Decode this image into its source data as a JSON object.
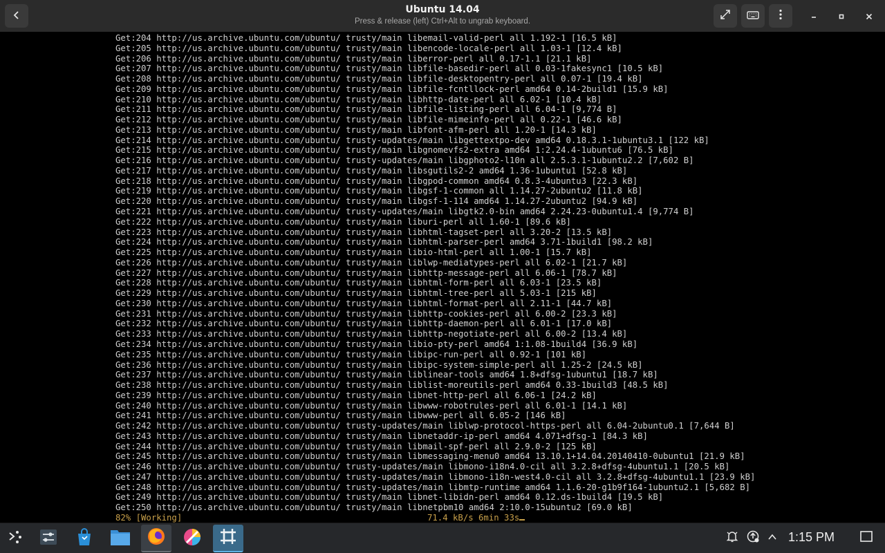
{
  "window": {
    "title": "Ubuntu 14.04",
    "subtitle": "Press & release (left) Ctrl+Alt to ungrab keyboard."
  },
  "icons": {
    "back": "chevron-left-icon",
    "fullscreen": "fullscreen-icon",
    "keyboard": "keyboard-icon",
    "menu": "vertical-dots-icon",
    "minimize": "minimize-icon",
    "maximize": "maximize-icon",
    "close": "close-icon"
  },
  "terminal": {
    "lines": [
      "Get:204 http://us.archive.ubuntu.com/ubuntu/ trusty/main libemail-valid-perl all 1.192-1 [16.5 kB]",
      "Get:205 http://us.archive.ubuntu.com/ubuntu/ trusty/main libencode-locale-perl all 1.03-1 [12.4 kB]",
      "Get:206 http://us.archive.ubuntu.com/ubuntu/ trusty/main liberror-perl all 0.17-1.1 [21.1 kB]",
      "Get:207 http://us.archive.ubuntu.com/ubuntu/ trusty/main libfile-basedir-perl all 0.03-1fakesync1 [10.5 kB]",
      "Get:208 http://us.archive.ubuntu.com/ubuntu/ trusty/main libfile-desktopentry-perl all 0.07-1 [19.4 kB]",
      "Get:209 http://us.archive.ubuntu.com/ubuntu/ trusty/main libfile-fcntllock-perl amd64 0.14-2build1 [15.9 kB]",
      "Get:210 http://us.archive.ubuntu.com/ubuntu/ trusty/main libhttp-date-perl all 6.02-1 [10.4 kB]",
      "Get:211 http://us.archive.ubuntu.com/ubuntu/ trusty/main libfile-listing-perl all 6.04-1 [9,774 B]",
      "Get:212 http://us.archive.ubuntu.com/ubuntu/ trusty/main libfile-mimeinfo-perl all 0.22-1 [46.6 kB]",
      "Get:213 http://us.archive.ubuntu.com/ubuntu/ trusty/main libfont-afm-perl all 1.20-1 [14.3 kB]",
      "Get:214 http://us.archive.ubuntu.com/ubuntu/ trusty-updates/main libgettextpo-dev amd64 0.18.3.1-1ubuntu3.1 [122 kB]",
      "Get:215 http://us.archive.ubuntu.com/ubuntu/ trusty/main libgnomevfs2-extra amd64 1:2.24.4-1ubuntu6 [76.5 kB]",
      "Get:216 http://us.archive.ubuntu.com/ubuntu/ trusty-updates/main libgphoto2-l10n all 2.5.3.1-1ubuntu2.2 [7,602 B]",
      "Get:217 http://us.archive.ubuntu.com/ubuntu/ trusty/main libsgutils2-2 amd64 1.36-1ubuntu1 [52.8 kB]",
      "Get:218 http://us.archive.ubuntu.com/ubuntu/ trusty/main libgpod-common amd64 0.8.3-4ubuntu3 [22.3 kB]",
      "Get:219 http://us.archive.ubuntu.com/ubuntu/ trusty/main libgsf-1-common all 1.14.27-2ubuntu2 [11.8 kB]",
      "Get:220 http://us.archive.ubuntu.com/ubuntu/ trusty/main libgsf-1-114 amd64 1.14.27-2ubuntu2 [94.9 kB]",
      "Get:221 http://us.archive.ubuntu.com/ubuntu/ trusty-updates/main libgtk2.0-bin amd64 2.24.23-0ubuntu1.4 [9,774 B]",
      "Get:222 http://us.archive.ubuntu.com/ubuntu/ trusty/main liburi-perl all 1.60-1 [89.6 kB]",
      "Get:223 http://us.archive.ubuntu.com/ubuntu/ trusty/main libhtml-tagset-perl all 3.20-2 [13.5 kB]",
      "Get:224 http://us.archive.ubuntu.com/ubuntu/ trusty/main libhtml-parser-perl amd64 3.71-1build1 [98.2 kB]",
      "Get:225 http://us.archive.ubuntu.com/ubuntu/ trusty/main libio-html-perl all 1.00-1 [15.7 kB]",
      "Get:226 http://us.archive.ubuntu.com/ubuntu/ trusty/main liblwp-mediatypes-perl all 6.02-1 [21.7 kB]",
      "Get:227 http://us.archive.ubuntu.com/ubuntu/ trusty/main libhttp-message-perl all 6.06-1 [78.7 kB]",
      "Get:228 http://us.archive.ubuntu.com/ubuntu/ trusty/main libhtml-form-perl all 6.03-1 [23.5 kB]",
      "Get:229 http://us.archive.ubuntu.com/ubuntu/ trusty/main libhtml-tree-perl all 5.03-1 [215 kB]",
      "Get:230 http://us.archive.ubuntu.com/ubuntu/ trusty/main libhtml-format-perl all 2.11-1 [44.7 kB]",
      "Get:231 http://us.archive.ubuntu.com/ubuntu/ trusty/main libhttp-cookies-perl all 6.00-2 [23.3 kB]",
      "Get:232 http://us.archive.ubuntu.com/ubuntu/ trusty/main libhttp-daemon-perl all 6.01-1 [17.0 kB]",
      "Get:233 http://us.archive.ubuntu.com/ubuntu/ trusty/main libhttp-negotiate-perl all 6.00-2 [13.4 kB]",
      "Get:234 http://us.archive.ubuntu.com/ubuntu/ trusty/main libio-pty-perl amd64 1:1.08-1build4 [36.9 kB]",
      "Get:235 http://us.archive.ubuntu.com/ubuntu/ trusty/main libipc-run-perl all 0.92-1 [101 kB]",
      "Get:236 http://us.archive.ubuntu.com/ubuntu/ trusty/main libipc-system-simple-perl all 1.25-2 [24.5 kB]",
      "Get:237 http://us.archive.ubuntu.com/ubuntu/ trusty/main liblinear-tools amd64 1.8+dfsg-1ubuntu1 [18.7 kB]",
      "Get:238 http://us.archive.ubuntu.com/ubuntu/ trusty/main liblist-moreutils-perl amd64 0.33-1build3 [48.5 kB]",
      "Get:239 http://us.archive.ubuntu.com/ubuntu/ trusty/main libnet-http-perl all 6.06-1 [24.2 kB]",
      "Get:240 http://us.archive.ubuntu.com/ubuntu/ trusty/main libwww-robotrules-perl all 6.01-1 [14.1 kB]",
      "Get:241 http://us.archive.ubuntu.com/ubuntu/ trusty/main libwww-perl all 6.05-2 [146 kB]",
      "Get:242 http://us.archive.ubuntu.com/ubuntu/ trusty-updates/main liblwp-protocol-https-perl all 6.04-2ubuntu0.1 [7,644 B]",
      "Get:243 http://us.archive.ubuntu.com/ubuntu/ trusty/main libnetaddr-ip-perl amd64 4.071+dfsg-1 [84.3 kB]",
      "Get:244 http://us.archive.ubuntu.com/ubuntu/ trusty/main libmail-spf-perl all 2.9.0-2 [125 kB]",
      "Get:245 http://us.archive.ubuntu.com/ubuntu/ trusty/main libmessaging-menu0 amd64 13.10.1+14.04.20140410-0ubuntu1 [21.9 kB]",
      "Get:246 http://us.archive.ubuntu.com/ubuntu/ trusty-updates/main libmono-i18n4.0-cil all 3.2.8+dfsg-4ubuntu1.1 [20.5 kB]",
      "Get:247 http://us.archive.ubuntu.com/ubuntu/ trusty-updates/main libmono-i18n-west4.0-cil all 3.2.8+dfsg-4ubuntu1.1 [23.9 kB]",
      "Get:248 http://us.archive.ubuntu.com/ubuntu/ trusty-updates/main libmtp-runtime amd64 1.1.6-20-g1b9f164-1ubuntu2.1 [5,682 B]",
      "Get:249 http://us.archive.ubuntu.com/ubuntu/ trusty/main libnet-libidn-perl amd64 0.12.ds-1build4 [19.5 kB]",
      "Get:250 http://us.archive.ubuntu.com/ubuntu/ trusty/main libnetpbm10 amd64 2:10.0-15ubuntu2 [69.0 kB]"
    ],
    "status_progress": "82% [Working]",
    "status_rate": "71.4 kB/s 6min 33s",
    "status_color": "#c8a04a",
    "text_color": "#d0d0d0"
  },
  "taskbar": {
    "items": [
      {
        "name": "application-launcher-icon"
      },
      {
        "name": "system-settings-icon"
      },
      {
        "name": "discover-store-icon"
      },
      {
        "name": "file-manager-icon"
      },
      {
        "name": "firefox-icon"
      },
      {
        "name": "color-picker-app-icon"
      },
      {
        "name": "virtual-machine-app-icon"
      }
    ],
    "tray": [
      "notifications-icon",
      "updates-icon",
      "chevron-up-icon"
    ],
    "clock": "1:15 PM",
    "show_desktop_icon": "show-desktop-icon"
  }
}
